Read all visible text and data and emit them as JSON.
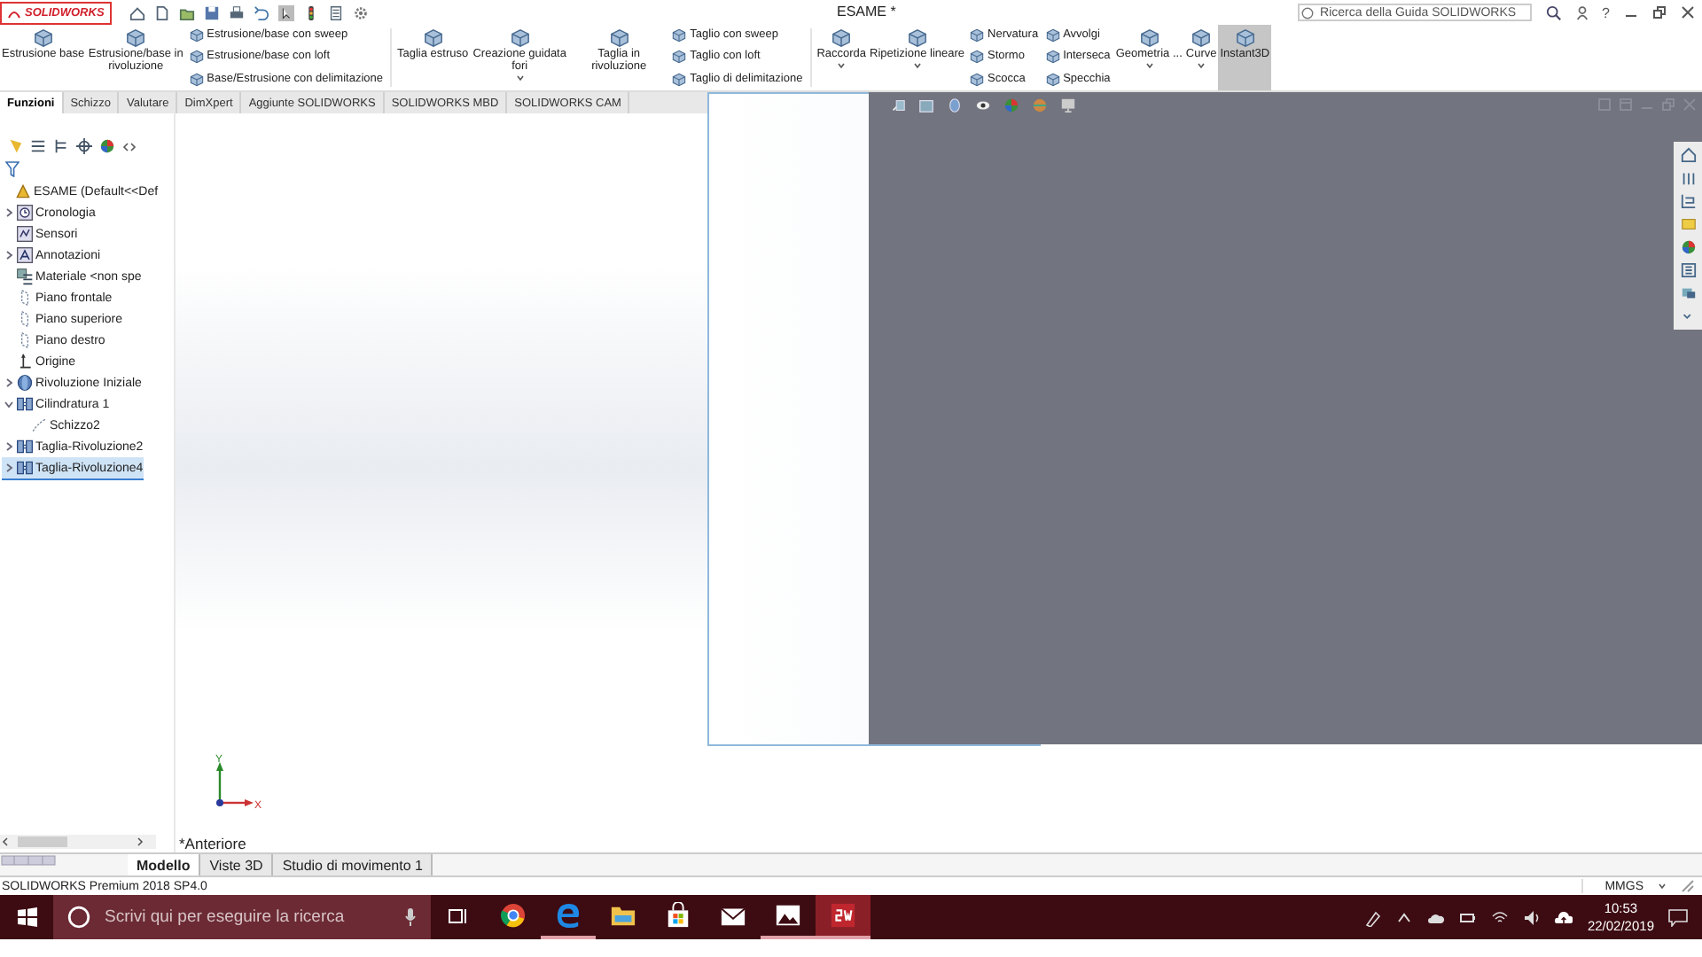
{
  "title_bar": {
    "logo": "SOLIDWORKS",
    "title": "ESAME *",
    "help_search": {
      "placeholder": "Ricerca della Guida SOLIDWORKS"
    },
    "help": "?"
  },
  "ribbon": {
    "groups": [
      {
        "kind": "large",
        "items": [
          {
            "label": "Estrusione base",
            "dropdown": false,
            "on": false
          },
          {
            "label": "Estrusione/base in rivoluzione",
            "dropdown": false,
            "on": false
          }
        ]
      },
      {
        "kind": "stack",
        "items": [
          {
            "label": "Estrusione/base con sweep"
          },
          {
            "label": "Estrusione/base con loft"
          },
          {
            "label": "Base/Estrusione con delimitazione"
          }
        ]
      },
      {
        "kind": "large",
        "items": [
          {
            "label": "Taglia estruso",
            "dropdown": false,
            "on": false
          },
          {
            "label": "Creazione guidata fori",
            "dropdown": true,
            "on": false
          },
          {
            "label": "Taglia in rivoluzione",
            "dropdown": false,
            "on": false
          }
        ]
      },
      {
        "kind": "stack",
        "items": [
          {
            "label": "Taglio con sweep"
          },
          {
            "label": "Taglio con loft"
          },
          {
            "label": "Taglio di delimitazione"
          }
        ]
      },
      {
        "kind": "large",
        "items": [
          {
            "label": "Raccorda",
            "dropdown": true,
            "on": false
          },
          {
            "label": "Ripetizione lineare",
            "dropdown": true,
            "on": false
          }
        ]
      },
      {
        "kind": "stack",
        "items": [
          {
            "label": "Nervatura"
          },
          {
            "label": "Stormo"
          },
          {
            "label": "Scocca"
          }
        ]
      },
      {
        "kind": "stack",
        "items": [
          {
            "label": "Avvolgi"
          },
          {
            "label": "Interseca"
          },
          {
            "label": "Specchia"
          }
        ]
      },
      {
        "kind": "large",
        "items": [
          {
            "label": "Geometria ...",
            "dropdown": true,
            "on": false
          },
          {
            "label": "Curve",
            "dropdown": true,
            "on": false
          },
          {
            "label": "Instant3D",
            "dropdown": false,
            "on": true
          }
        ]
      }
    ]
  },
  "command_tabs": [
    {
      "label": "Funzioni",
      "selected": true
    },
    {
      "label": "Schizzo",
      "selected": false
    },
    {
      "label": "Valutare",
      "selected": false
    },
    {
      "label": "DimXpert",
      "selected": false
    },
    {
      "label": "Aggiunte SOLIDWORKS",
      "selected": false
    },
    {
      "label": "SOLIDWORKS MBD",
      "selected": false
    },
    {
      "label": "SOLIDWORKS CAM",
      "selected": false
    }
  ],
  "feature_tree": {
    "root": {
      "label": "ESAME  (Default<<Def",
      "kind": "part",
      "selected": false,
      "children": [
        {
          "label": "Cronologia",
          "kind": "history",
          "expanded": false,
          "selected": false
        },
        {
          "label": "Sensori",
          "kind": "sensor",
          "selected": false
        },
        {
          "label": "Annotazioni",
          "kind": "annotation",
          "expanded": false,
          "selected": false
        },
        {
          "label": "Materiale <non spe",
          "kind": "material",
          "selected": false
        },
        {
          "label": "Piano frontale",
          "kind": "plane",
          "selected": false
        },
        {
          "label": "Piano superiore",
          "kind": "plane",
          "selected": false
        },
        {
          "label": "Piano destro",
          "kind": "plane",
          "selected": false
        },
        {
          "label": "Origine",
          "kind": "origin",
          "selected": false
        },
        {
          "label": "Rivoluzione Iniziale",
          "kind": "revolve",
          "expanded": false,
          "selected": false
        },
        {
          "label": "Cilindratura 1",
          "kind": "cut",
          "expanded": true,
          "selected": false,
          "children": [
            {
              "label": "Schizzo2",
              "kind": "sketch",
              "selected": false
            }
          ]
        },
        {
          "label": "Taglia-Rivoluzione2",
          "kind": "cut",
          "expanded": false,
          "selected": false
        },
        {
          "label": "Taglia-Rivoluzione4",
          "kind": "cut",
          "expanded": false,
          "selected": true
        }
      ]
    }
  },
  "graphics": {
    "view_label": "*Anteriore",
    "triad": {
      "y_label": "Y",
      "x_label": "X"
    }
  },
  "bottom_tabs": [
    {
      "label": "Modello",
      "selected": true
    },
    {
      "label": "Viste 3D",
      "selected": false
    },
    {
      "label": "Studio di movimento 1",
      "selected": false
    }
  ],
  "status_bar": {
    "product": "SOLIDWORKS Premium 2018 SP4.0",
    "units": "MMGS"
  },
  "taskbar": {
    "search": {
      "placeholder": "Scrivi qui per eseguire la ricerca"
    },
    "apps": [
      {
        "kind": "chrome",
        "running": false,
        "active": false
      },
      {
        "kind": "edge",
        "running": true,
        "active": false
      },
      {
        "kind": "explorer",
        "running": false,
        "active": false
      },
      {
        "kind": "store",
        "running": false,
        "active": false
      },
      {
        "kind": "mail",
        "running": false,
        "active": false
      },
      {
        "kind": "photos",
        "running": true,
        "active": false
      },
      {
        "kind": "solidworks",
        "running": true,
        "active": true
      }
    ],
    "time": "10:53",
    "date": "22/02/2019"
  }
}
